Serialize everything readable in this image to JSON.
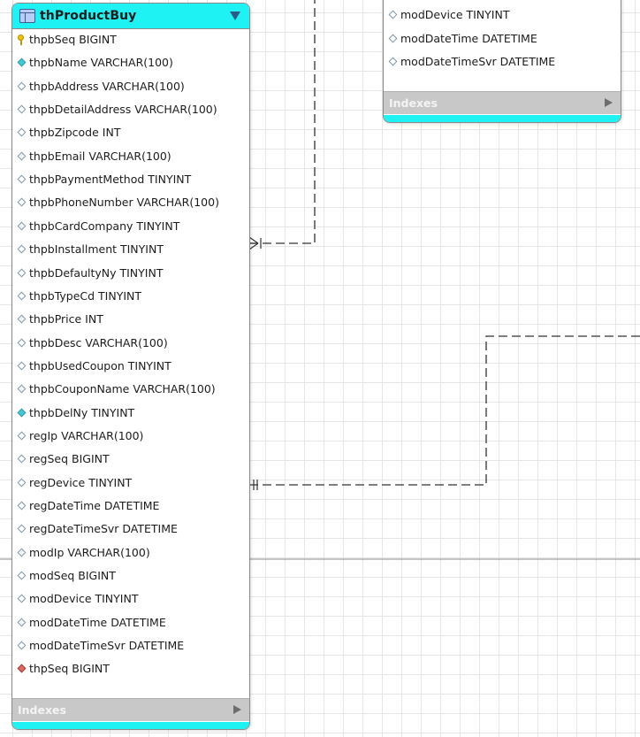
{
  "colors": {
    "header": "#1ef2f2",
    "indexes_bar": "#c8c8c8",
    "connector": "#333333",
    "grid": "#e6e6e6"
  },
  "tables": {
    "product_buy": {
      "title": "thProductBuy",
      "indexes_label": "Indexes",
      "columns": [
        {
          "text": "thpbSeq BIGINT",
          "icon": "pk"
        },
        {
          "text": "thpbName VARCHAR(100)",
          "icon": "notnull"
        },
        {
          "text": "thpbAddress VARCHAR(100)",
          "icon": "plain"
        },
        {
          "text": "thpbDetailAddress VARCHAR(100)",
          "icon": "plain"
        },
        {
          "text": "thpbZipcode INT",
          "icon": "plain"
        },
        {
          "text": "thpbEmail VARCHAR(100)",
          "icon": "plain"
        },
        {
          "text": "thpbPaymentMethod TINYINT",
          "icon": "plain"
        },
        {
          "text": "thpbPhoneNumber VARCHAR(100)",
          "icon": "plain"
        },
        {
          "text": "thpbCardCompany TINYINT",
          "icon": "plain"
        },
        {
          "text": "thpbInstallment TINYINT",
          "icon": "plain"
        },
        {
          "text": "thpbDefaultyNy TINYINT",
          "icon": "plain"
        },
        {
          "text": "thpbTypeCd TINYINT",
          "icon": "plain"
        },
        {
          "text": "thpbPrice INT",
          "icon": "plain"
        },
        {
          "text": "thpbDesc VARCHAR(100)",
          "icon": "plain"
        },
        {
          "text": "thpbUsedCoupon TINYINT",
          "icon": "plain"
        },
        {
          "text": "thpbCouponName VARCHAR(100)",
          "icon": "plain"
        },
        {
          "text": "thpbDelNy TINYINT",
          "icon": "notnull"
        },
        {
          "text": "regIp VARCHAR(100)",
          "icon": "plain"
        },
        {
          "text": "regSeq BIGINT",
          "icon": "plain"
        },
        {
          "text": "regDevice TINYINT",
          "icon": "plain"
        },
        {
          "text": "regDateTime DATETIME",
          "icon": "plain"
        },
        {
          "text": "regDateTimeSvr DATETIME",
          "icon": "plain"
        },
        {
          "text": "modIp VARCHAR(100)",
          "icon": "plain"
        },
        {
          "text": "modSeq BIGINT",
          "icon": "plain"
        },
        {
          "text": "modDevice TINYINT",
          "icon": "plain"
        },
        {
          "text": "modDateTime DATETIME",
          "icon": "plain"
        },
        {
          "text": "modDateTimeSvr DATETIME",
          "icon": "plain"
        },
        {
          "text": "thpSeq BIGINT",
          "icon": "fk"
        }
      ]
    },
    "partial_top": {
      "indexes_label": "Indexes",
      "columns": [
        {
          "text": "modDevice TINYINT",
          "icon": "plain"
        },
        {
          "text": "modDateTime DATETIME",
          "icon": "plain"
        },
        {
          "text": "modDateTimeSvr DATETIME",
          "icon": "plain"
        }
      ]
    }
  },
  "relationships": [
    {
      "name": "product-buy-to-top-table",
      "from_end": "many",
      "to_end": "one"
    },
    {
      "name": "product-buy-to-right-table",
      "from_end": "one-and-only-one",
      "to_end": "offscreen"
    }
  ]
}
